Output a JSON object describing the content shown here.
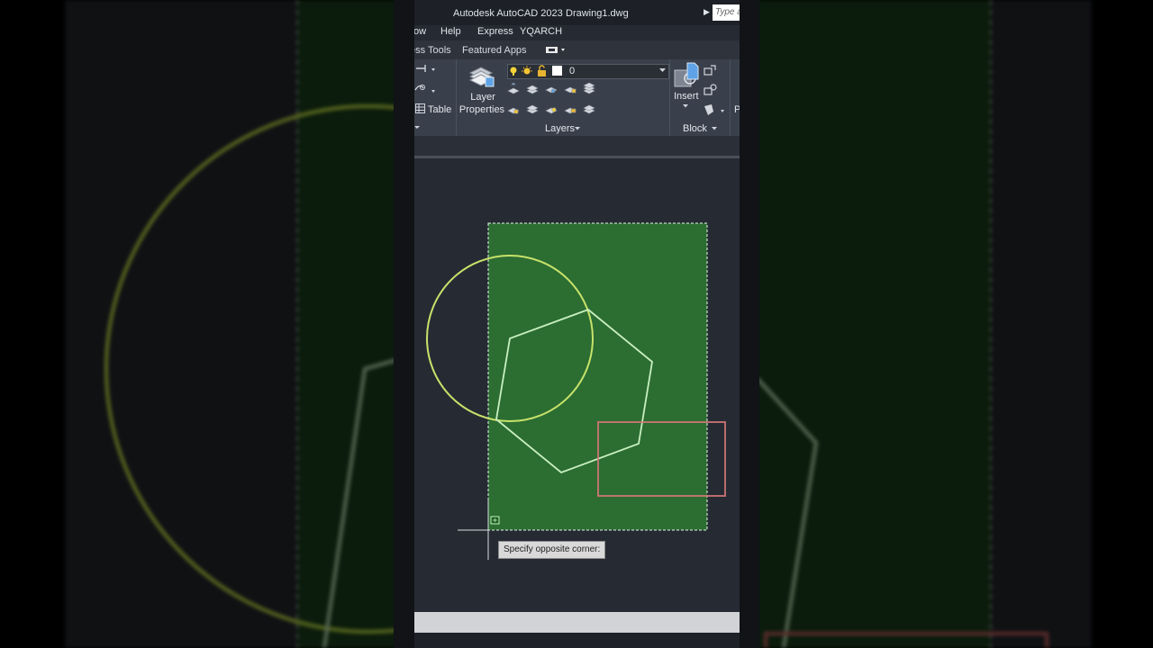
{
  "titlebar": {
    "app_name": "Autodesk AutoCAD 2023",
    "file_name": "Drawing1.dwg",
    "search_placeholder": "Type a"
  },
  "menu": {
    "items": [
      "ow",
      "Help",
      "Express",
      "YQARCH"
    ]
  },
  "ribbon_tabs": {
    "items": [
      "ess Tools",
      "Featured Apps"
    ]
  },
  "ribbon": {
    "table_label": "Table",
    "layer_properties_label_1": "Layer",
    "layer_properties_label_2": "Properties",
    "current_layer": "0",
    "layers_panel_title": "Layers",
    "insert_label": "Insert",
    "block_panel_title": "Block",
    "clipped_label": "P"
  },
  "prompt": {
    "tooltip": "Specify opposite corner:"
  },
  "colors": {
    "selection_fill": "#2e7d32",
    "circle": "#c8e36a",
    "polygon": "#c9f0c0",
    "rectangle": "#d67878",
    "background": "#262b33"
  }
}
